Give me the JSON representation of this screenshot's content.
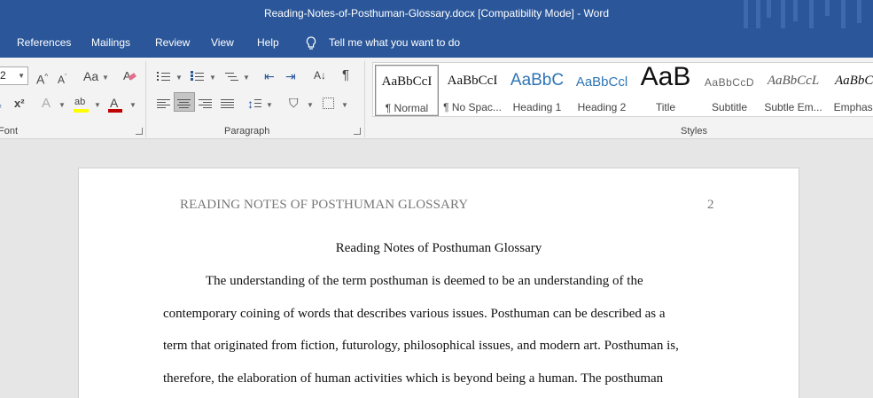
{
  "window": {
    "title": "Reading-Notes-of-Posthuman-Glossary.docx [Compatibility Mode]  -  Word"
  },
  "tabs": [
    "References",
    "Mailings",
    "Review",
    "View",
    "Help"
  ],
  "tell_me": "Tell me what you want to do",
  "ribbon": {
    "font_size": "2",
    "groups": {
      "font": "Font",
      "paragraph": "Paragraph",
      "styles": "Styles"
    },
    "styles": [
      {
        "preview": "AaBbCcI",
        "label": "¶ Normal",
        "selected": true
      },
      {
        "preview": "AaBbCcI",
        "label": "¶ No Spac..."
      },
      {
        "preview": "AaBbC",
        "label": "Heading 1"
      },
      {
        "preview": "AaBbCcl",
        "label": "Heading 2"
      },
      {
        "preview": "AaB",
        "label": "Title"
      },
      {
        "preview": "AaBbCcD",
        "label": "Subtitle"
      },
      {
        "preview": "AaBbCcL",
        "label": "Subtle Em..."
      },
      {
        "preview": "AaBbCc",
        "label": "Emphasis"
      }
    ],
    "colors": {
      "highlight": "#ffff00",
      "font_color": "#c00000",
      "accent": "#2b579a"
    }
  },
  "document": {
    "header": "READING NOTES OF POSTHUMAN GLOSSARY",
    "page_number": "2",
    "title": "Reading Notes of Posthuman Glossary",
    "lines": [
      "The understanding of the term posthuman is deemed to be an understanding of the",
      "contemporary coining of words that describes various issues. Posthuman can be described as a",
      "term that originated from fiction, futurology, philosophical issues, and modern art. Posthuman is,",
      "therefore, the elaboration of human activities which is beyond being a human. The posthuman"
    ]
  }
}
